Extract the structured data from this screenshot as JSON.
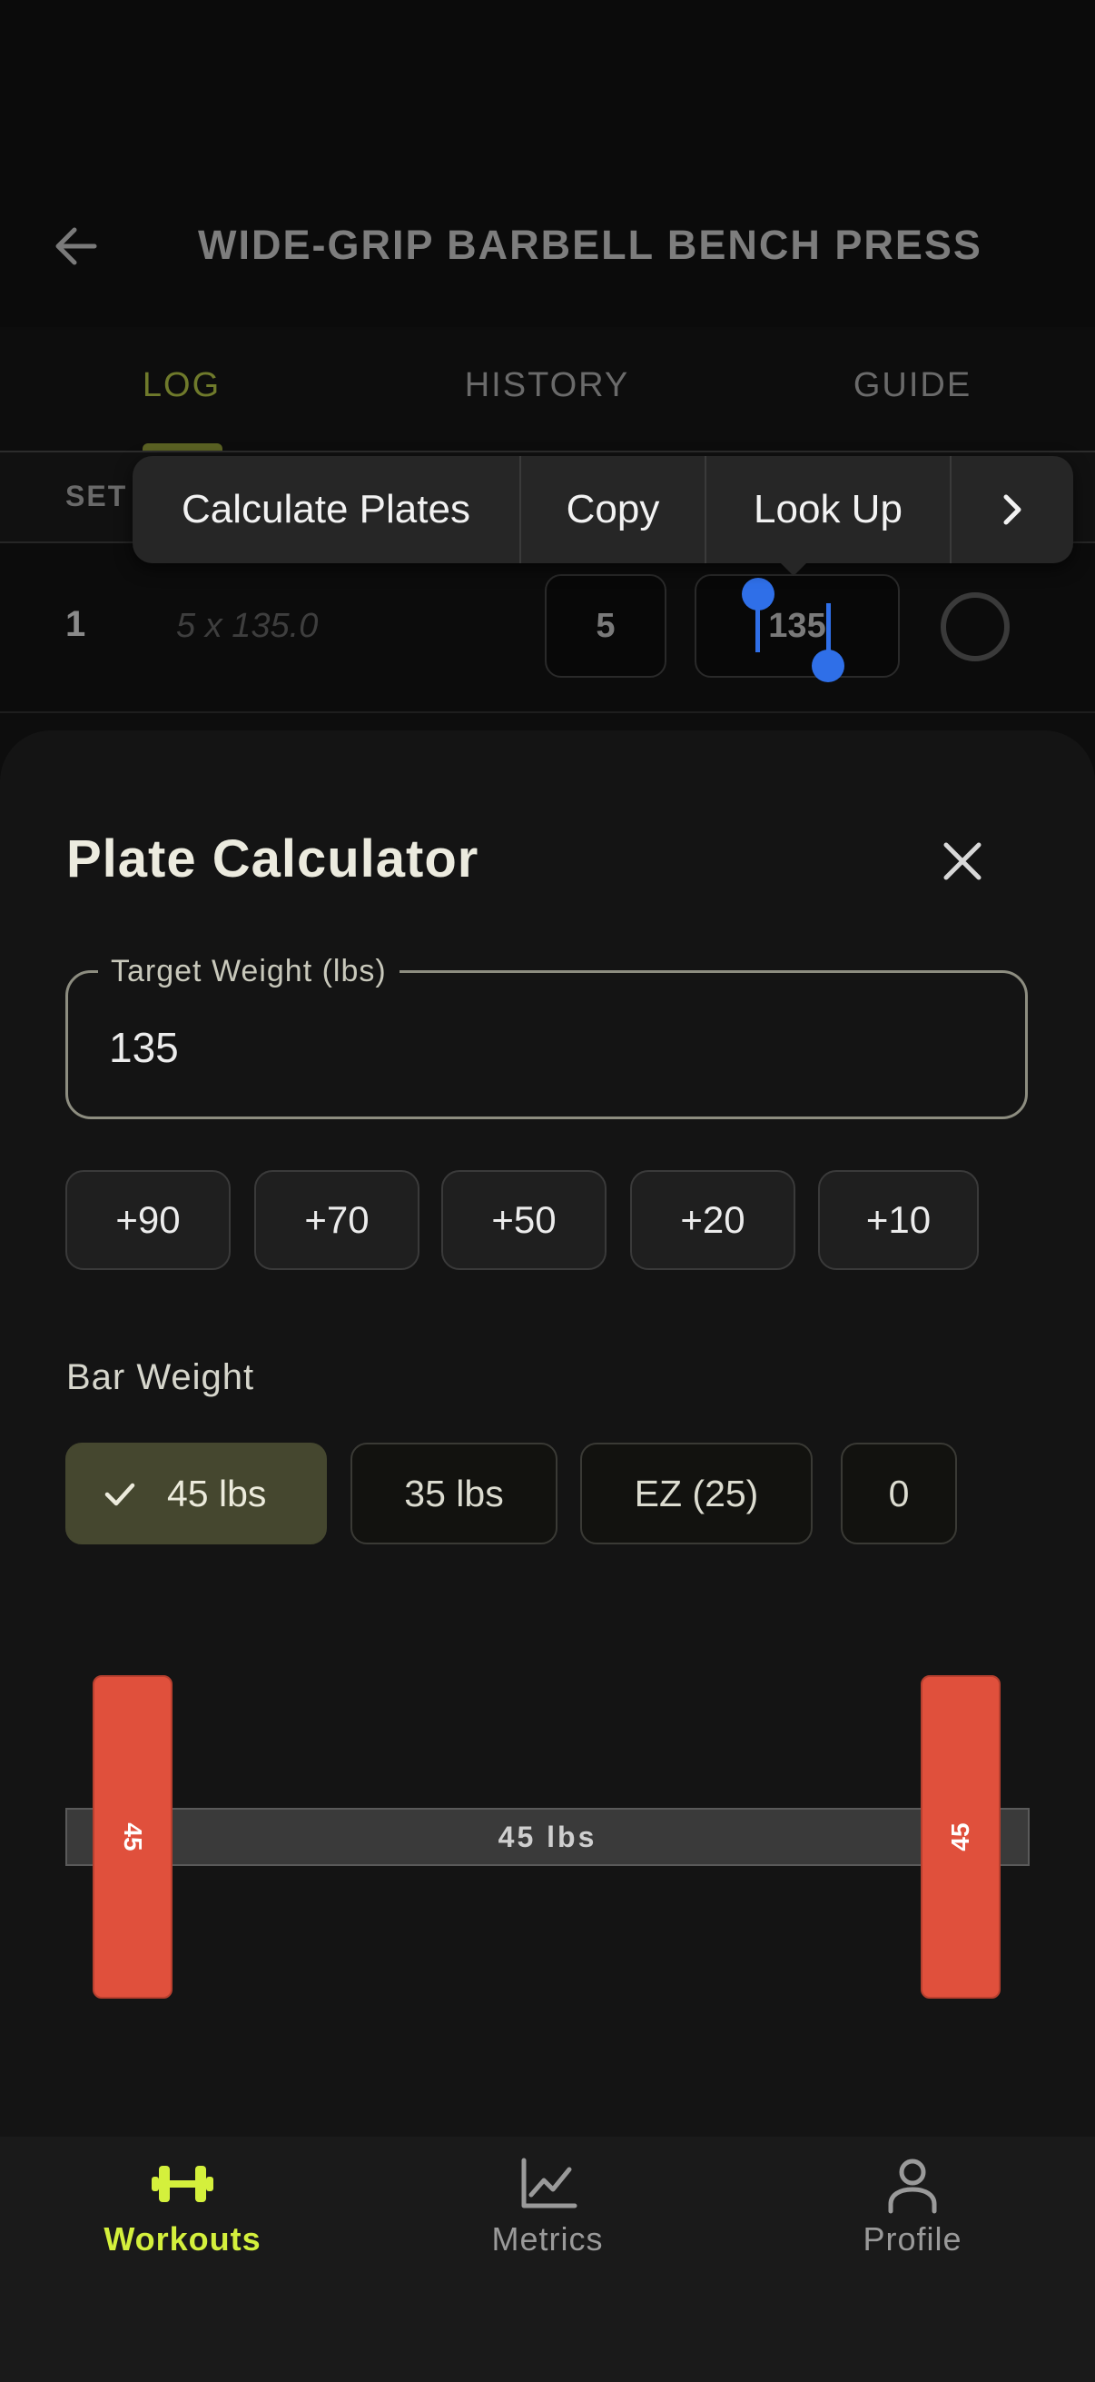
{
  "header": {
    "title": "WIDE-GRIP BARBELL BENCH PRESS"
  },
  "tabs": [
    {
      "label": "LOG"
    },
    {
      "label": "HISTORY"
    },
    {
      "label": "GUIDE"
    }
  ],
  "log": {
    "column_set": "SET",
    "row": {
      "set": "1",
      "previous": "5 x 135.0",
      "reps": "5",
      "weight": "135"
    }
  },
  "context_menu": {
    "items": [
      "Calculate Plates",
      "Copy",
      "Look Up"
    ]
  },
  "plate_calculator": {
    "title": "Plate Calculator",
    "target_label": "Target Weight (lbs)",
    "target_value": "135",
    "increments": [
      "+90",
      "+70",
      "+50",
      "+20",
      "+10"
    ],
    "bar_weight_label": "Bar Weight",
    "bar_options": [
      {
        "label": "45 lbs",
        "selected": true
      },
      {
        "label": "35 lbs",
        "selected": false
      },
      {
        "label": "EZ (25)",
        "selected": false
      },
      {
        "label": "0",
        "selected": false
      }
    ],
    "bar_label": "45 lbs",
    "plates": [
      "45",
      "45"
    ]
  },
  "nav": {
    "items": [
      {
        "label": "Workouts",
        "active": true
      },
      {
        "label": "Metrics",
        "active": false
      },
      {
        "label": "Profile",
        "active": false
      }
    ]
  },
  "colors": {
    "accent": "#d4f03c",
    "plate": "#e0503c",
    "selection": "#2f6fe8",
    "selected_chip": "#45472f"
  }
}
